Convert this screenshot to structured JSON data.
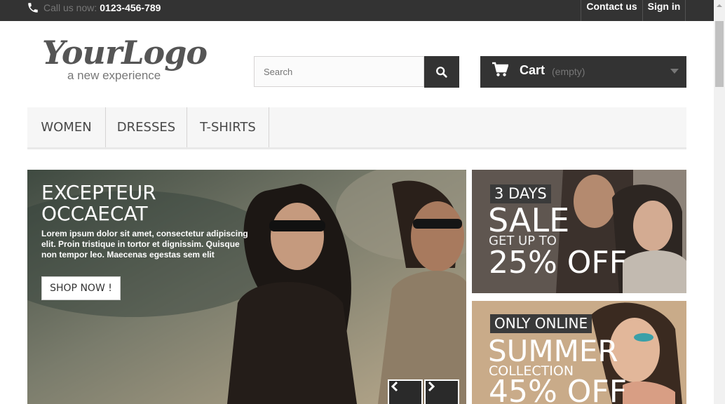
{
  "topbar": {
    "phone_label": "Call us now:",
    "phone_number": "0123-456-789",
    "contact_label": "Contact us",
    "signin_label": "Sign in"
  },
  "logo": {
    "text": "YourLogo",
    "tagline": "a new experience"
  },
  "search": {
    "placeholder": "Search",
    "icon": "search-icon"
  },
  "cart": {
    "label": "Cart",
    "status": "(empty)",
    "icon": "cart-icon"
  },
  "menu": {
    "items": [
      {
        "label": "WOMEN"
      },
      {
        "label": "DRESSES"
      },
      {
        "label": "T-SHIRTS"
      }
    ]
  },
  "slider": {
    "title_line1": "EXCEPTEUR",
    "title_line2": "OCCAECAT",
    "text": "Lorem ipsum dolor sit amet, consectetur adipiscing elit. Proin tristique in tortor et dignissim. Quisque non tempor leo. Maecenas egestas sem elit",
    "button": "SHOP NOW !"
  },
  "banners": [
    {
      "badge": "3 DAYS",
      "headline": "SALE",
      "subline": "GET UP TO",
      "offer": "25% OFF"
    },
    {
      "badge": "ONLY ONLINE",
      "headline": "SUMMER",
      "subline": "COLLECTION",
      "offer": "45% OFF"
    }
  ],
  "colors": {
    "dark": "#333333",
    "menu_bg": "#f6f6f6",
    "text": "#484848"
  }
}
